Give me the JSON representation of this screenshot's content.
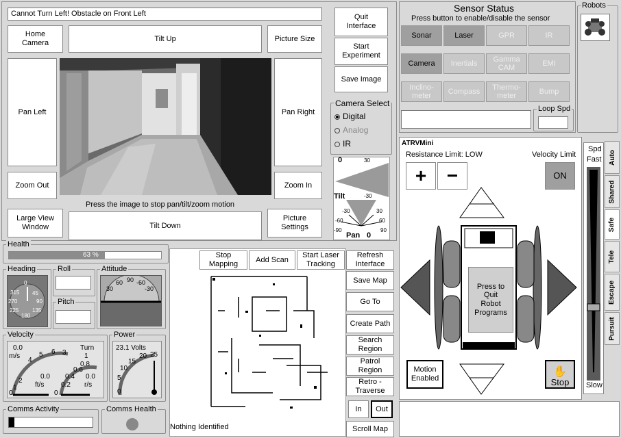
{
  "status_message": "Cannot Turn Left! Obstacle on Front Left",
  "camera": {
    "home_camera": "Home\nCamera",
    "tilt_up": "Tilt Up",
    "picture_size": "Picture Size",
    "pan_left": "Pan Left",
    "pan_right": "Pan Right",
    "zoom_out": "Zoom Out",
    "zoom_in": "Zoom In",
    "press_hint": "Press the image to stop pan/tilt/zoom motion",
    "large_view": "Large View\nWindow",
    "tilt_down": "Tilt Down",
    "picture_settings": "Picture\nSettings"
  },
  "experiment": {
    "quit": "Quit\nInterface",
    "start": "Start\nExperiment",
    "save_image": "Save Image"
  },
  "camera_select": {
    "title": "Camera Select",
    "options": [
      "Digital",
      "Analog",
      "IR"
    ],
    "selected": "Digital"
  },
  "tilt_pan_gauge": {
    "tilt_label": "Tilt",
    "tilt_value": "0",
    "tilt_ticks": [
      "30",
      "-30"
    ],
    "pan_label": "Pan",
    "pan_value": "0",
    "pan_ticks_left": [
      "-30",
      "-60",
      "-90"
    ],
    "pan_ticks_right": [
      "30",
      "60",
      "90"
    ]
  },
  "sensor_status": {
    "title": "Sensor Status",
    "subtitle": "Press button to enable/disable the sensor",
    "sensors": [
      {
        "label": "Sonar",
        "on": true
      },
      {
        "label": "Laser",
        "on": true
      },
      {
        "label": "GPR",
        "on": false
      },
      {
        "label": "IR",
        "on": false
      },
      {
        "label": "Camera",
        "on": true
      },
      {
        "label": "Inertials",
        "on": false
      },
      {
        "label": "Gamma\nCAM",
        "on": false
      },
      {
        "label": "EMI",
        "on": false
      },
      {
        "label": "Inclino-\nmeter",
        "on": false
      },
      {
        "label": "Compass",
        "on": false
      },
      {
        "label": "Thermo-\nmeter",
        "on": false
      },
      {
        "label": "Bump",
        "on": false
      }
    ],
    "loop_spd_label": "Loop Spd"
  },
  "robots": {
    "title": "Robots"
  },
  "health": {
    "title": "Health",
    "percent_text": "63 %",
    "percent": 0.63
  },
  "heading": {
    "title": "Heading",
    "ticks": [
      "0",
      "45",
      "90",
      "135",
      "180",
      "225",
      "270",
      "315"
    ]
  },
  "roll": {
    "title": "Roll"
  },
  "pitch": {
    "title": "Pitch"
  },
  "attitude": {
    "title": "Attitude",
    "ticks": [
      "30",
      "60",
      "90",
      "-60",
      "-30"
    ]
  },
  "velocity": {
    "title": "Velocity",
    "left_value": "0.0",
    "left_unit": "m/s",
    "left_ticks": [
      "2",
      "1",
      "0"
    ],
    "mid_ticks": [
      "3",
      "4",
      "5",
      "6"
    ],
    "fts_unit": "ft/s",
    "fts_value": "0.0",
    "turn_label": "Turn",
    "turn_ticks": [
      "1",
      "0.8",
      "0.6",
      "0.4",
      "0.2"
    ],
    "turn_value": "0.0",
    "rs_unit": "r/s",
    "zero_label": "0"
  },
  "power": {
    "title": "Power",
    "volts": "23.1 Volts",
    "ticks": [
      "0",
      "5",
      "10",
      "15",
      "20",
      "25"
    ]
  },
  "comms_activity": {
    "title": "Comms Activity"
  },
  "comms_health": {
    "title": "Comms Health"
  },
  "mapping": {
    "stop_mapping": "Stop\nMapping",
    "add_scan": "Add Scan",
    "start_laser": "Start Laser\nTracking",
    "refresh": "Refresh\nInterface",
    "save_map": "Save Map",
    "go_to": "Go To",
    "create_path": "Create Path",
    "search_region": "Search\nRegion",
    "patrol_region": "Patrol\nRegion",
    "retro_traverse": "Retro -\nTraverse",
    "zoom_in": "In",
    "zoom_out": "Out",
    "scroll_map": "Scroll Map",
    "identified": "Nothing Identified"
  },
  "robot_control": {
    "robot_name": "ATRVMini",
    "resistance": "Resistance Limit: LOW",
    "velocity_limit": "Velocity Limit",
    "velocity_on": "ON",
    "plus": "+",
    "minus": "−",
    "press_to_quit": "Press to\nQuit\nRobot\nPrograms",
    "motion_enabled": "Motion\nEnabled",
    "stop": "Stop"
  },
  "speed": {
    "spd_label": "Spd",
    "fast_label": "Fast",
    "slow_label": "Slow"
  },
  "modes": [
    "Auto",
    "Shared",
    "Safe",
    "Tele",
    "Escape",
    "Pursuit"
  ],
  "colors": {
    "background": "#d9d9d9",
    "sensor_on": "#9f9f9f",
    "sensor_off": "#c8c8c8",
    "stop_button": "#d0d0d0"
  }
}
